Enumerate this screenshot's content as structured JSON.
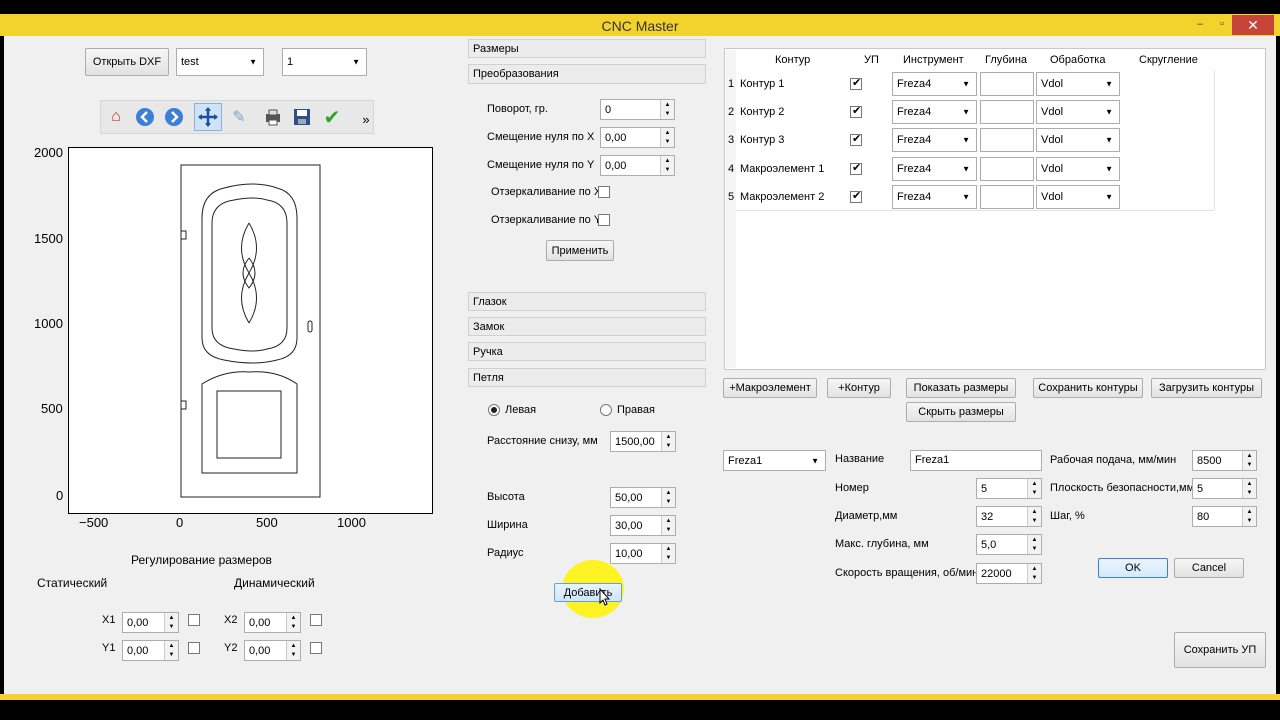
{
  "window": {
    "title": "CNC Master",
    "minimize": "–",
    "maximize": "▫",
    "close": "✕"
  },
  "toolbar_top": {
    "open_dxf": "Открыть DXF",
    "combo1": "test",
    "combo2": "1"
  },
  "toolbar_icons": [
    "home-icon",
    "back-icon",
    "forward-icon",
    "move-icon",
    "edit-icon",
    "print-icon",
    "save-icon",
    "check-icon",
    "more-icon"
  ],
  "plot": {
    "ytick_labels": [
      "2000",
      "1500",
      "1000",
      "500",
      "0"
    ],
    "xtick_labels": [
      "−500",
      "0",
      "500",
      "1000"
    ]
  },
  "size_adjust": {
    "title": "Регулирование размеров",
    "static": "Статический",
    "dynamic": "Динамический",
    "x1_label": "X1",
    "x1_value": "0,00",
    "y1_label": "Y1",
    "y1_value": "0,00",
    "x2_label": "X2",
    "x2_value": "0,00",
    "y2_label": "Y2",
    "y2_value": "0,00"
  },
  "sections": {
    "sizes": "Размеры",
    "transforms": "Преобразования",
    "peephole": "Глазок",
    "lock": "Замок",
    "handle": "Ручка",
    "hinge": "Петля"
  },
  "transforms": {
    "rotation_label": "Поворот, гр.",
    "rotation_value": "0",
    "offset_x_label": "Смещение нуля по X",
    "offset_x_value": "0,00",
    "offset_y_label": "Смещение нуля по Y",
    "offset_y_value": "0,00",
    "mirror_x_label": "Отзеркаливание по X",
    "mirror_y_label": "Отзеркаливание по Y",
    "apply": "Применить"
  },
  "hinge": {
    "left": "Левая",
    "right": "Правая",
    "distance_label": "Расстояние снизу, мм",
    "distance_value": "1500,00",
    "height_label": "Высота",
    "height_value": "50,00",
    "width_label": "Ширина",
    "width_value": "30,00",
    "radius_label": "Радиус",
    "radius_value": "10,00",
    "add": "Добавить"
  },
  "contour_table": {
    "headers": [
      "Контур",
      "УП",
      "Инструмент",
      "Глубина",
      "Обработка",
      "Скругление"
    ],
    "rows": [
      {
        "num": "1",
        "name": "Контур 1",
        "tool": "Freza4",
        "processing": "Vdol"
      },
      {
        "num": "2",
        "name": "Контур 2",
        "tool": "Freza4",
        "processing": "Vdol"
      },
      {
        "num": "3",
        "name": "Контур 3",
        "tool": "Freza4",
        "processing": "Vdol"
      },
      {
        "num": "4",
        "name": "Макроэлемент 1",
        "tool": "Freza4",
        "processing": "Vdol"
      },
      {
        "num": "5",
        "name": "Макроэлемент 2",
        "tool": "Freza4",
        "processing": "Vdol"
      }
    ]
  },
  "contour_buttons": {
    "add_macro": "+Макроэлемент",
    "add_contour": "+Контур",
    "show_sizes": "Показать размеры",
    "hide_sizes": "Скрыть размеры",
    "save_contours": "Сохранить контуры",
    "load_contours": "Загрузить контуры"
  },
  "tool": {
    "select": "Freza1",
    "name_label": "Название",
    "name_value": "Freza1",
    "number_label": "Номер",
    "number_value": "5",
    "diameter_label": "Диаметр,мм",
    "diameter_value": "32",
    "max_depth_label": "Макс. глубина, мм",
    "max_depth_value": "5,0",
    "speed_label": "Скорость вращения, об/мин",
    "speed_value": "22000",
    "feed_label": "Рабочая подача, мм/мин",
    "feed_value": "8500",
    "safe_plane_label": "Плоскость безопасности,мм",
    "safe_plane_value": "5",
    "step_label": "Шаг, %",
    "step_value": "80",
    "ok": "OK",
    "cancel": "Cancel"
  },
  "save_nc": "Сохранить УП",
  "colors": {
    "titlebar": "#f3d22d",
    "highlight": "#fff200",
    "close": "#c7443a"
  }
}
